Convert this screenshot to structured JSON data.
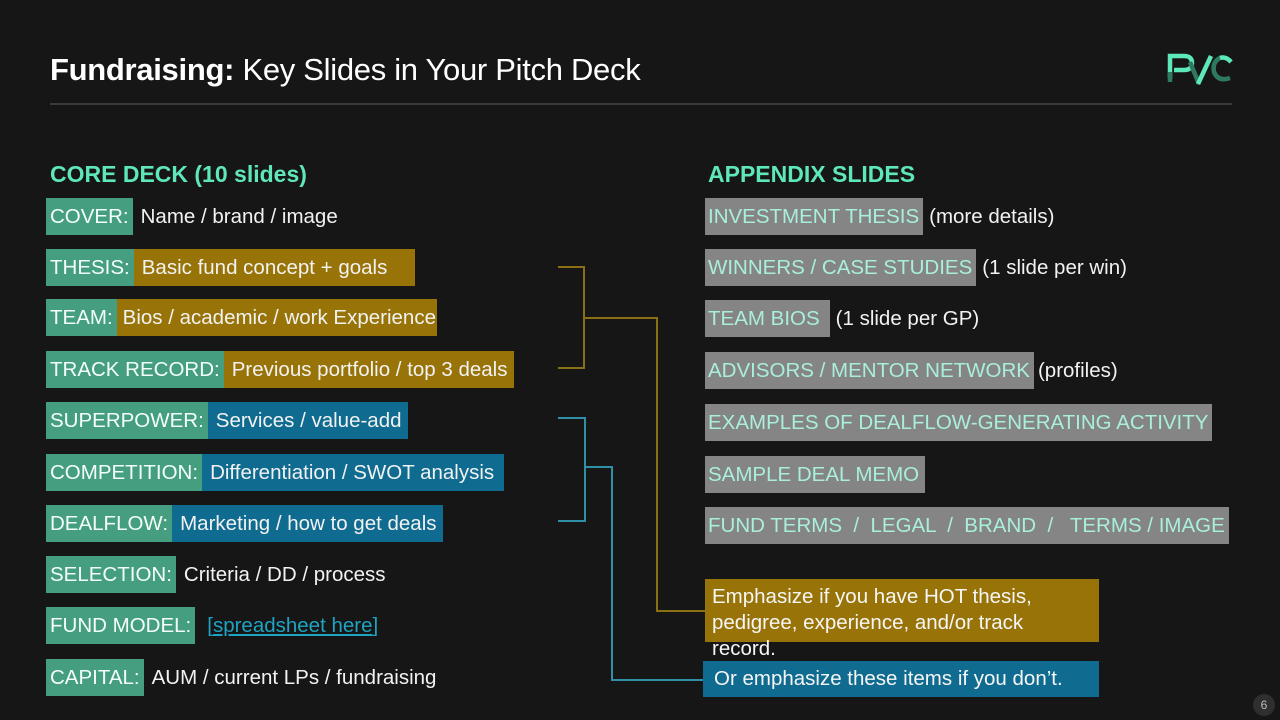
{
  "header": {
    "title_bold": "Fundraising:",
    "title_rest": " Key Slides in Your Pitch Deck",
    "logo_text": "PVC",
    "logo_icon": "pvc-logo-icon"
  },
  "colors": {
    "background": "#161616",
    "accent_green": "#5ee8b9",
    "label_green": "#459e7f",
    "gold": "#987408",
    "blue": "#0f6b8f",
    "appendix_gray": "#858585",
    "link": "#1ea3c2"
  },
  "core_deck": {
    "heading": "CORE DECK  (10 slides)",
    "items": [
      {
        "label": "COVER:",
        "description": "Name / brand / image",
        "highlight": "none"
      },
      {
        "label": "THESIS:",
        "description": "Basic fund concept + goals",
        "highlight": "gold"
      },
      {
        "label": "TEAM:",
        "description": "Bios / academic / work Experience",
        "highlight": "gold"
      },
      {
        "label": "TRACK RECORD:",
        "description": "Previous portfolio / top 3 deals",
        "highlight": "gold"
      },
      {
        "label": "SUPERPOWER:",
        "description": "Services / value-add",
        "highlight": "blue"
      },
      {
        "label": "COMPETITION:",
        "description": "Differentiation / SWOT analysis",
        "highlight": "blue"
      },
      {
        "label": "DEALFLOW:",
        "description": "Marketing / how to get deals",
        "highlight": "blue"
      },
      {
        "label": "SELECTION:",
        "description": "Criteria / DD / process",
        "highlight": "none"
      },
      {
        "label": "FUND MODEL:",
        "description": "spreadsheet here",
        "link_open": "[ ",
        "link_close": " ]",
        "highlight": "link"
      },
      {
        "label": "CAPITAL:",
        "description": "AUM / current LPs / fundraising",
        "highlight": "none"
      }
    ]
  },
  "appendix": {
    "heading": "APPENDIX SLIDES",
    "items": [
      {
        "label": "INVESTMENT THESIS",
        "note": "(more details)"
      },
      {
        "label": "WINNERS / CASE STUDIES",
        "note": "(1 slide per win)"
      },
      {
        "label": "TEAM BIOS ",
        "note": "(1 slide per GP)"
      },
      {
        "label": "ADVISORS / MENTOR NETWORK",
        "note": "(profiles)"
      },
      {
        "label": "EXAMPLES OF DEALFLOW-GENERATING ACTIVITY",
        "note": ""
      },
      {
        "label": "SAMPLE DEAL MEMO",
        "note": ""
      },
      {
        "label": "FUND TERMS  /  LEGAL  /  BRAND  /   TERMS / IMAGE",
        "note": ""
      }
    ]
  },
  "callouts": {
    "gold": "Emphasize if you have HOT thesis, pedigree, experience, and/or track record.",
    "blue": "Or emphasize these items if you don’t."
  },
  "page_number": "6"
}
